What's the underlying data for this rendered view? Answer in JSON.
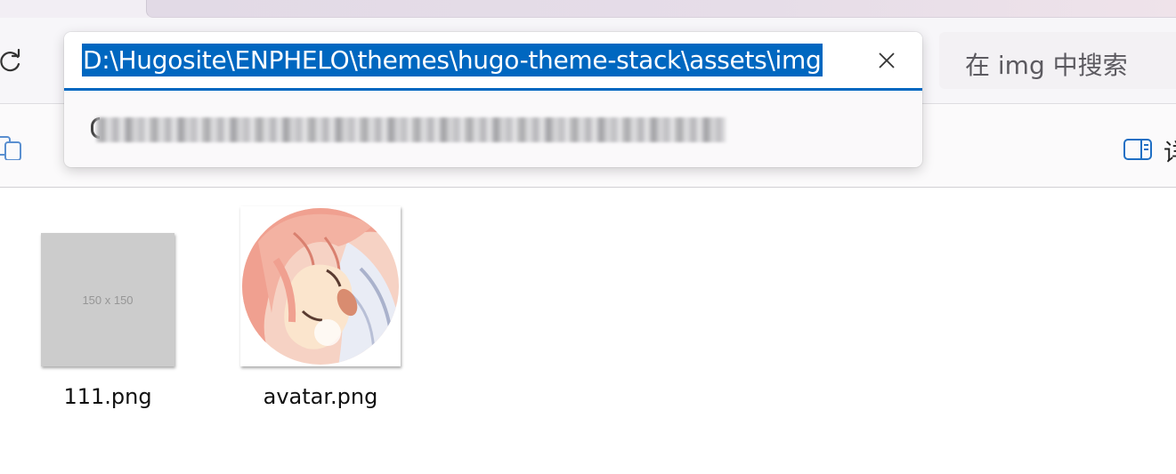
{
  "address_bar": {
    "path": "D:\\Hugosite\\ENPHELO\\themes\\hugo-theme-stack\\assets\\img"
  },
  "search": {
    "placeholder": "在 img 中搜索"
  },
  "command_bar": {
    "cut_off_label": "详"
  },
  "files": [
    {
      "name": "111.png",
      "thumbnail_text": "150 x 150"
    },
    {
      "name": "avatar.png"
    }
  ],
  "colors": {
    "accent": "#0067c0",
    "placeholder_thumb": "#cccccc",
    "avatar_hair": "#f0a090",
    "avatar_skin": "#fbe5cd"
  }
}
